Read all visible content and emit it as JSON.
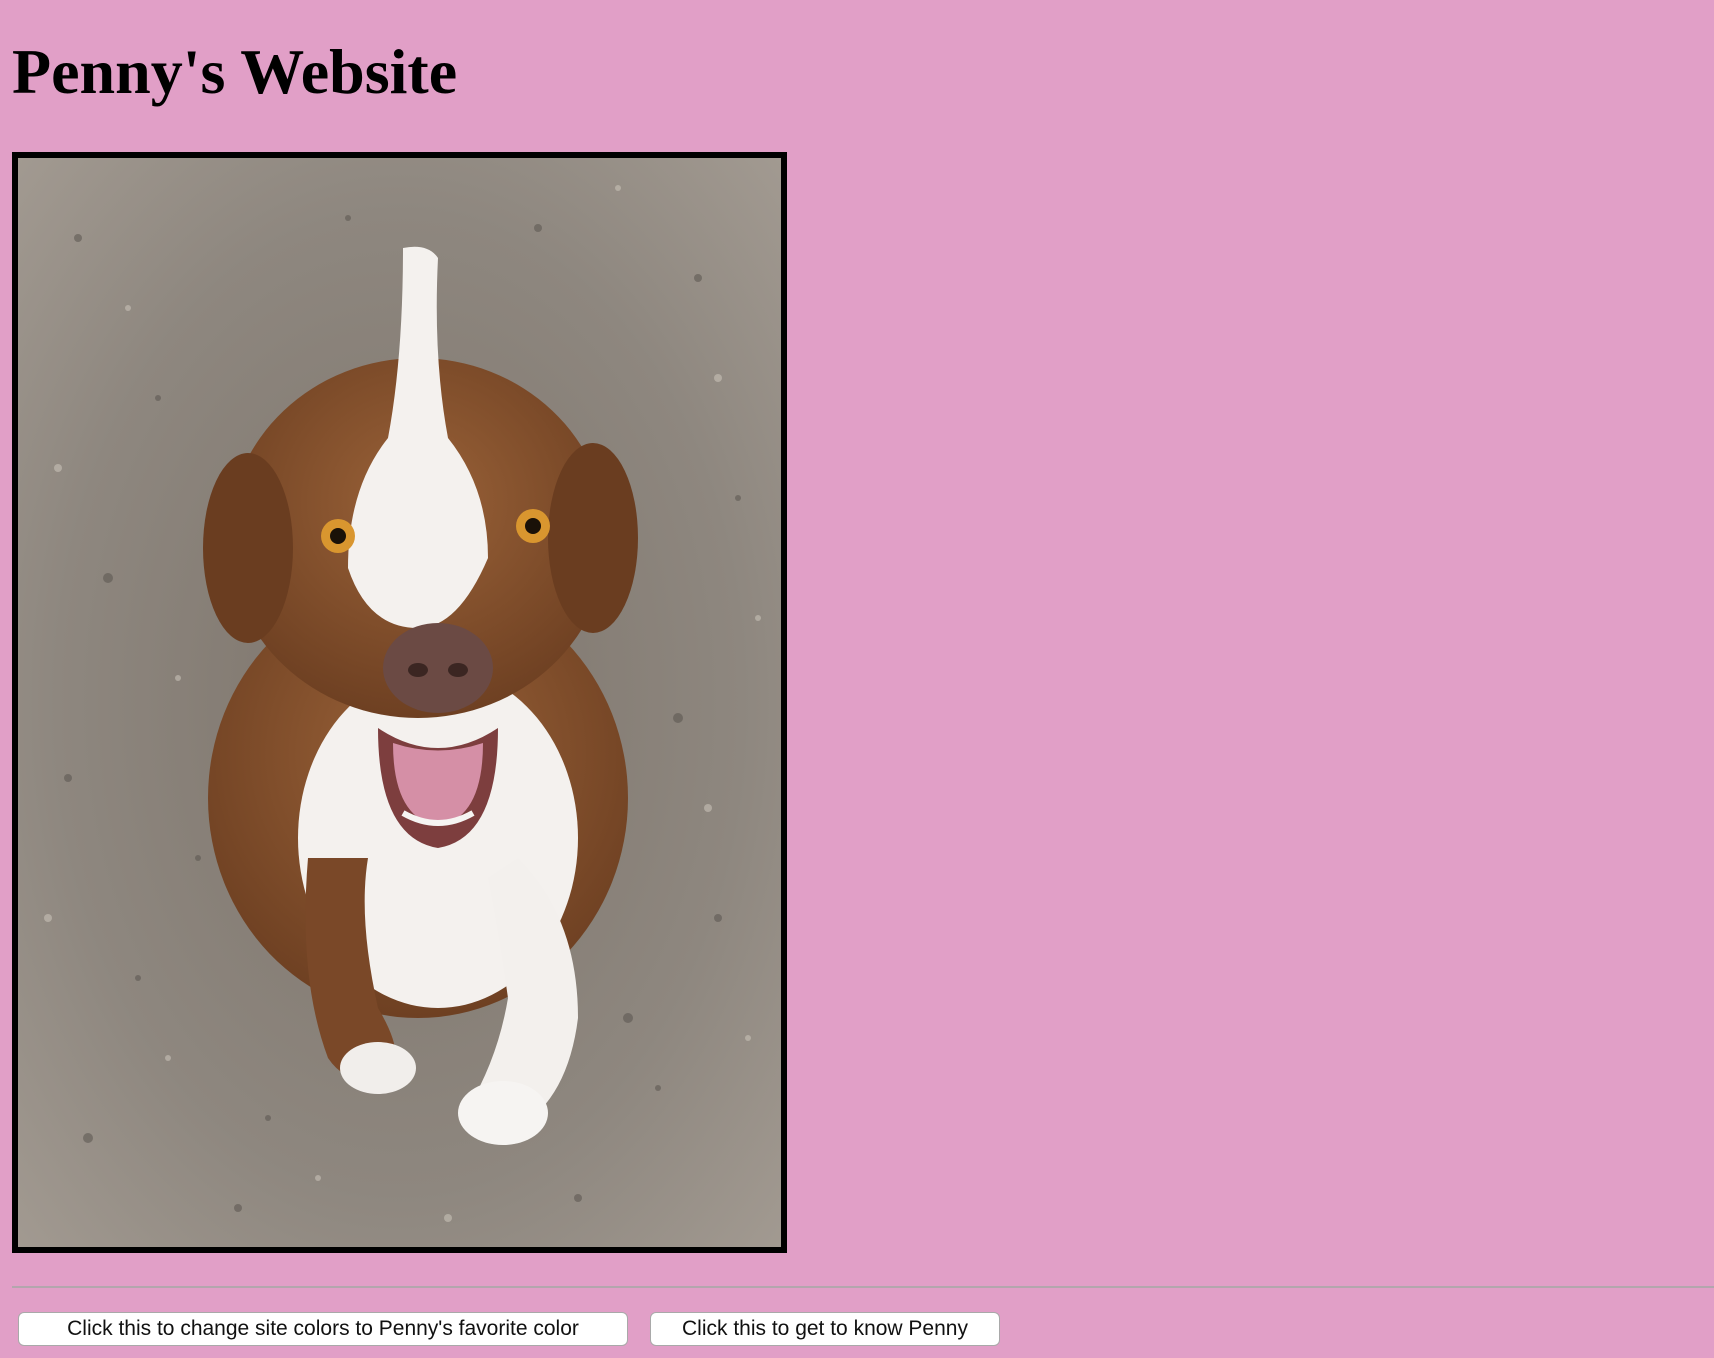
{
  "page": {
    "title": "Penny's Website",
    "background_color": "#e19fc7"
  },
  "photo": {
    "subject": "dog-photo",
    "border_color": "#000000"
  },
  "buttons": {
    "change_colors_label": "Click this to change site colors to Penny's favorite color",
    "get_to_know_label": "Click this to get to know Penny"
  }
}
